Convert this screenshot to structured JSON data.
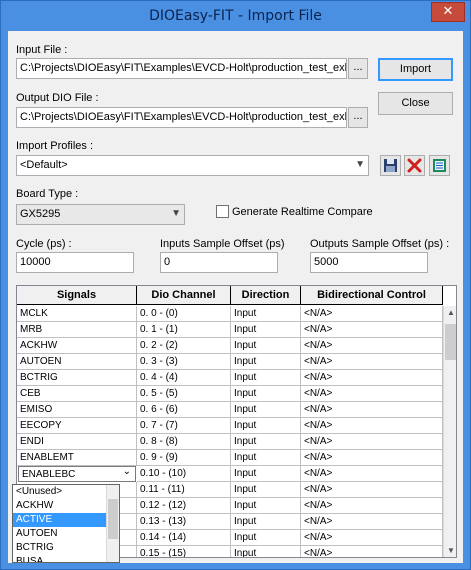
{
  "window": {
    "title": "DIOEasy-FIT - Import File",
    "close_glyph": "✕"
  },
  "input_file": {
    "label": "Input File :",
    "value": "C:\\Projects\\DIOEasy\\FIT\\Examples\\EVCD-Holt\\production_test_exl",
    "browse": "..."
  },
  "output_file": {
    "label": "Output DIO File :",
    "value": "C:\\Projects\\DIOEasy\\FIT\\Examples\\EVCD-Holt\\production_test_exl",
    "browse": "..."
  },
  "buttons": {
    "import": "Import",
    "close": "Close"
  },
  "profiles": {
    "label": "Import Profiles :",
    "value": "<Default>",
    "icons": [
      "save-icon",
      "delete-icon",
      "profile-list-icon"
    ]
  },
  "board": {
    "label": "Board Type :",
    "value": "GX5295"
  },
  "realtime": {
    "label": "Generate Realtime Compare",
    "checked": false
  },
  "cycle": {
    "label": "Cycle (ps) :",
    "value": "10000"
  },
  "inputs_offset": {
    "label": "Inputs Sample Offset (ps)",
    "value": "0"
  },
  "outputs_offset": {
    "label": "Outputs Sample Offset (ps) :",
    "value": "5000"
  },
  "table": {
    "headers": [
      "Signals",
      "Dio Channel",
      "Direction",
      "Bidirectional Control"
    ],
    "rows": [
      [
        "MCLK",
        "0. 0 - (0)",
        "Input",
        "<N/A>"
      ],
      [
        "MRB",
        "0. 1 - (1)",
        "Input",
        "<N/A>"
      ],
      [
        "ACKHW",
        "0. 2 - (2)",
        "Input",
        "<N/A>"
      ],
      [
        "AUTOEN",
        "0. 3 - (3)",
        "Input",
        "<N/A>"
      ],
      [
        "BCTRIG",
        "0. 4 - (4)",
        "Input",
        "<N/A>"
      ],
      [
        "CEB",
        "0. 5 - (5)",
        "Input",
        "<N/A>"
      ],
      [
        "EMISO",
        "0. 6 - (6)",
        "Input",
        "<N/A>"
      ],
      [
        "EECOPY",
        "0. 7 - (7)",
        "Input",
        "<N/A>"
      ],
      [
        "ENDI",
        "0. 8 - (8)",
        "Input",
        "<N/A>"
      ],
      [
        "ENABLEMT",
        "0. 9 - (9)",
        "Input",
        "<N/A>"
      ],
      [
        "ENABLEBC",
        "0.10 - (10)",
        "Input",
        "<N/A>"
      ],
      [
        "",
        "0.11 - (11)",
        "Input",
        "<N/A>"
      ],
      [
        "",
        "0.12 - (12)",
        "Input",
        "<N/A>"
      ],
      [
        "",
        "0.13 - (13)",
        "Input",
        "<N/A>"
      ],
      [
        "",
        "0.14 - (14)",
        "Input",
        "<N/A>"
      ],
      [
        "",
        "0.15 - (15)",
        "Input",
        "<N/A>"
      ]
    ],
    "editing_signal": "ENABLEBC",
    "dropdown_options": [
      "<Unused>",
      "ACKHW",
      "ACTIVE",
      "AUTOEN",
      "BCTRIG",
      "BUSA"
    ],
    "dropdown_selected": "ACTIVE"
  }
}
